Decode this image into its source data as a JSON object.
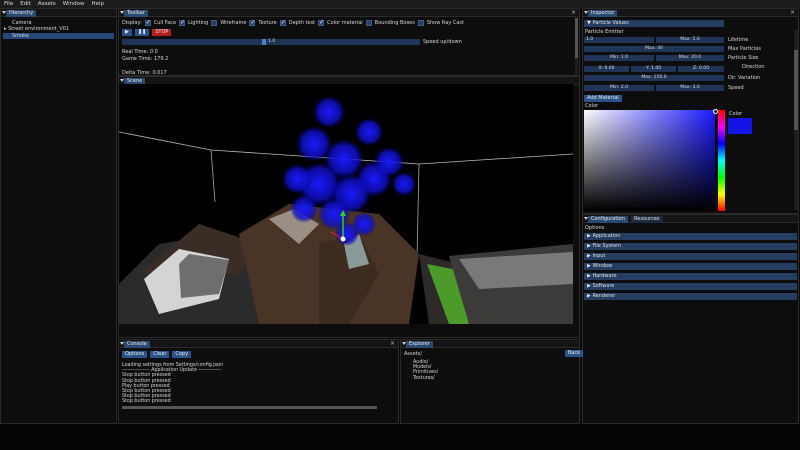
{
  "menubar": [
    "File",
    "Edit",
    "Assets",
    "Window",
    "Help"
  ],
  "hierarchy": {
    "title": "Hierarchy",
    "items": [
      "Camera",
      "Street environment_V01",
      "Smoke"
    ]
  },
  "toolbar": {
    "title": "Toolbar",
    "display_label": "Display:",
    "options": [
      {
        "label": "Cull Face",
        "checked": true
      },
      {
        "label": "Lighting",
        "checked": true
      },
      {
        "label": "Wireframe",
        "checked": false
      },
      {
        "label": "Texture",
        "checked": true
      },
      {
        "label": "Depth test",
        "checked": true
      },
      {
        "label": "Color material",
        "checked": true
      },
      {
        "label": "Bounding Boxes",
        "checked": false
      },
      {
        "label": "Show Ray Cast",
        "checked": false
      }
    ],
    "play_icon": "▶",
    "pause_icon": "❚❚",
    "stop_label": "STOP",
    "speed_value": "1.0",
    "speed_label": "Speed up/down",
    "real_time": "Real Time: 0.0",
    "game_time": "Game Time: 179.2",
    "delta_time": "Delta Time: 0.017"
  },
  "scene": {
    "title": "Scene"
  },
  "inspector": {
    "title": "Inspector",
    "section": "Particle Values",
    "emitter": "Particle Emitter",
    "min_val": "1.0",
    "max_label": "Max: 5.0",
    "lifetime": "Lifetime",
    "max_particles_field": "Max: 40",
    "max_particles": "Max Particles",
    "min_size": "Min: 1.0",
    "max_size": "Max: 20.0",
    "particle_size": "Particle Size",
    "direction": "Direction",
    "dx": "X: 0.00",
    "dy": "Y: 1.00",
    "dz": "Z: 0.00",
    "dir_variation_field": "Max: 150.0",
    "dir_variation": "Dir. Variation",
    "speed_min": "Min: 2.0",
    "speed_max": "Max: 3.0",
    "speed": "Speed",
    "add_material": "Add Material",
    "color_label": "Color",
    "color_swatch_label": "Color",
    "selected_color": "#1414e6"
  },
  "config": {
    "tab1": "Configuration",
    "tab2": "Resources",
    "options_label": "Options",
    "items": [
      "Application",
      "File System",
      "Input",
      "Window",
      "Hardware",
      "Software",
      "Renderer"
    ]
  },
  "console": {
    "title": "Console",
    "buttons": [
      "Options",
      "Clear",
      "Copy"
    ],
    "lines": [
      "Loading settings from Settings/config.json",
      "---------------- Application Update -------------",
      "Stop button pressed",
      "Stop button pressed",
      "Play button pressed",
      "Stop button pressed",
      "Stop button pressed",
      "Stop button pressed"
    ]
  },
  "explorer": {
    "title": "Explorer",
    "path": "Assets/",
    "back": "Back",
    "items": [
      "Audio/",
      "Models/",
      "Primitives/",
      "Textures/"
    ]
  }
}
